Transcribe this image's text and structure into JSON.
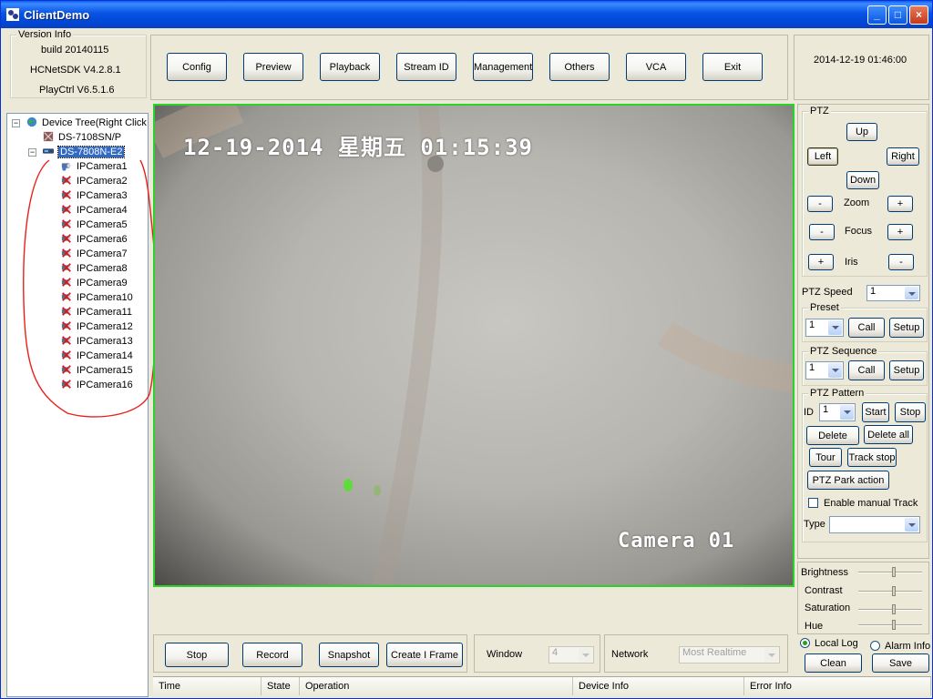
{
  "window": {
    "title": "ClientDemo",
    "minimize": "_",
    "maximize": "□",
    "close": "×"
  },
  "version_info": {
    "label": "Version Info",
    "build": "build 20140115",
    "sdk": "HCNetSDK V4.2.8.1",
    "playctrl": "PlayCtrl V6.5.1.6"
  },
  "toolbar": {
    "config": "Config",
    "preview": "Preview",
    "playback": "Playback",
    "stream_id": "Stream ID",
    "management": "Management",
    "others": "Others",
    "vca": "VCA",
    "exit": "Exit"
  },
  "datetime": "2014-12-19  01:46:00",
  "tree": {
    "root": "Device Tree(Right Click",
    "device1": "DS-7108SN/P",
    "device2": "DS-7808N-E2",
    "cameras": [
      "IPCamera1",
      "IPCamera2",
      "IPCamera3",
      "IPCamera4",
      "IPCamera5",
      "IPCamera6",
      "IPCamera7",
      "IPCamera8",
      "IPCamera9",
      "IPCamera10",
      "IPCamera11",
      "IPCamera12",
      "IPCamera13",
      "IPCamera14",
      "IPCamera15",
      "IPCamera16"
    ]
  },
  "video": {
    "timestamp": "12-19-2014 星期五 01:15:39",
    "camera_name": "Camera 01"
  },
  "ptz": {
    "label": "PTZ",
    "up": "Up",
    "left": "Left",
    "right": "Right",
    "down": "Down",
    "zoom": "Zoom",
    "focus": "Focus",
    "iris": "Iris",
    "minus": "-",
    "plus": "+",
    "speed_label": "PTZ Speed",
    "speed_value": "1",
    "preset": {
      "label": "Preset",
      "value": "1",
      "call": "Call",
      "setup": "Setup"
    },
    "sequence": {
      "label": "PTZ Sequence",
      "value": "1",
      "call": "Call",
      "setup": "Setup"
    },
    "pattern": {
      "label": "PTZ Pattern",
      "id_label": "ID",
      "id_value": "1",
      "start": "Start",
      "stop": "Stop",
      "delete": "Delete",
      "delete_all": "Delete all",
      "tour": "Tour",
      "track_stop": "Track stop",
      "park_action": "PTZ Park action",
      "enable_manual_track": "Enable manual Track",
      "type_label": "Type",
      "type_value": ""
    }
  },
  "image_adjust": {
    "brightness": "Brightness",
    "contrast": "Contrast",
    "saturation": "Saturation",
    "hue": "Hue"
  },
  "log": {
    "local_log": "Local Log",
    "alarm_info": "Alarm Info",
    "clean": "Clean",
    "save": "Save"
  },
  "controls": {
    "stop": "Stop",
    "record": "Record",
    "snapshot": "Snapshot",
    "create_iframe": "Create I Frame"
  },
  "window_select": {
    "label": "Window",
    "value": "4"
  },
  "network": {
    "label": "Network",
    "value": "Most Realtime"
  },
  "list_columns": [
    "Time",
    "State",
    "Operation",
    "Device Info",
    "Error Info"
  ],
  "colors": {
    "title_bar": "#0054e3",
    "video_border": "#2bd22b",
    "annotation": "#e8201c",
    "selection": "#316ac5"
  }
}
